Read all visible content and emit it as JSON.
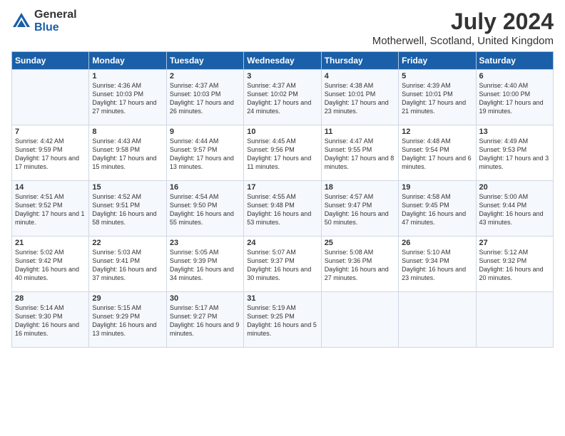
{
  "header": {
    "logo_general": "General",
    "logo_blue": "Blue",
    "title": "July 2024",
    "subtitle": "Motherwell, Scotland, United Kingdom"
  },
  "weekdays": [
    "Sunday",
    "Monday",
    "Tuesday",
    "Wednesday",
    "Thursday",
    "Friday",
    "Saturday"
  ],
  "weeks": [
    [
      {
        "day": "",
        "sunrise": "",
        "sunset": "",
        "daylight": ""
      },
      {
        "day": "1",
        "sunrise": "Sunrise: 4:36 AM",
        "sunset": "Sunset: 10:03 PM",
        "daylight": "Daylight: 17 hours and 27 minutes."
      },
      {
        "day": "2",
        "sunrise": "Sunrise: 4:37 AM",
        "sunset": "Sunset: 10:03 PM",
        "daylight": "Daylight: 17 hours and 26 minutes."
      },
      {
        "day": "3",
        "sunrise": "Sunrise: 4:37 AM",
        "sunset": "Sunset: 10:02 PM",
        "daylight": "Daylight: 17 hours and 24 minutes."
      },
      {
        "day": "4",
        "sunrise": "Sunrise: 4:38 AM",
        "sunset": "Sunset: 10:01 PM",
        "daylight": "Daylight: 17 hours and 23 minutes."
      },
      {
        "day": "5",
        "sunrise": "Sunrise: 4:39 AM",
        "sunset": "Sunset: 10:01 PM",
        "daylight": "Daylight: 17 hours and 21 minutes."
      },
      {
        "day": "6",
        "sunrise": "Sunrise: 4:40 AM",
        "sunset": "Sunset: 10:00 PM",
        "daylight": "Daylight: 17 hours and 19 minutes."
      }
    ],
    [
      {
        "day": "7",
        "sunrise": "Sunrise: 4:42 AM",
        "sunset": "Sunset: 9:59 PM",
        "daylight": "Daylight: 17 hours and 17 minutes."
      },
      {
        "day": "8",
        "sunrise": "Sunrise: 4:43 AM",
        "sunset": "Sunset: 9:58 PM",
        "daylight": "Daylight: 17 hours and 15 minutes."
      },
      {
        "day": "9",
        "sunrise": "Sunrise: 4:44 AM",
        "sunset": "Sunset: 9:57 PM",
        "daylight": "Daylight: 17 hours and 13 minutes."
      },
      {
        "day": "10",
        "sunrise": "Sunrise: 4:45 AM",
        "sunset": "Sunset: 9:56 PM",
        "daylight": "Daylight: 17 hours and 11 minutes."
      },
      {
        "day": "11",
        "sunrise": "Sunrise: 4:47 AM",
        "sunset": "Sunset: 9:55 PM",
        "daylight": "Daylight: 17 hours and 8 minutes."
      },
      {
        "day": "12",
        "sunrise": "Sunrise: 4:48 AM",
        "sunset": "Sunset: 9:54 PM",
        "daylight": "Daylight: 17 hours and 6 minutes."
      },
      {
        "day": "13",
        "sunrise": "Sunrise: 4:49 AM",
        "sunset": "Sunset: 9:53 PM",
        "daylight": "Daylight: 17 hours and 3 minutes."
      }
    ],
    [
      {
        "day": "14",
        "sunrise": "Sunrise: 4:51 AM",
        "sunset": "Sunset: 9:52 PM",
        "daylight": "Daylight: 17 hours and 1 minute."
      },
      {
        "day": "15",
        "sunrise": "Sunrise: 4:52 AM",
        "sunset": "Sunset: 9:51 PM",
        "daylight": "Daylight: 16 hours and 58 minutes."
      },
      {
        "day": "16",
        "sunrise": "Sunrise: 4:54 AM",
        "sunset": "Sunset: 9:50 PM",
        "daylight": "Daylight: 16 hours and 55 minutes."
      },
      {
        "day": "17",
        "sunrise": "Sunrise: 4:55 AM",
        "sunset": "Sunset: 9:48 PM",
        "daylight": "Daylight: 16 hours and 53 minutes."
      },
      {
        "day": "18",
        "sunrise": "Sunrise: 4:57 AM",
        "sunset": "Sunset: 9:47 PM",
        "daylight": "Daylight: 16 hours and 50 minutes."
      },
      {
        "day": "19",
        "sunrise": "Sunrise: 4:58 AM",
        "sunset": "Sunset: 9:45 PM",
        "daylight": "Daylight: 16 hours and 47 minutes."
      },
      {
        "day": "20",
        "sunrise": "Sunrise: 5:00 AM",
        "sunset": "Sunset: 9:44 PM",
        "daylight": "Daylight: 16 hours and 43 minutes."
      }
    ],
    [
      {
        "day": "21",
        "sunrise": "Sunrise: 5:02 AM",
        "sunset": "Sunset: 9:42 PM",
        "daylight": "Daylight: 16 hours and 40 minutes."
      },
      {
        "day": "22",
        "sunrise": "Sunrise: 5:03 AM",
        "sunset": "Sunset: 9:41 PM",
        "daylight": "Daylight: 16 hours and 37 minutes."
      },
      {
        "day": "23",
        "sunrise": "Sunrise: 5:05 AM",
        "sunset": "Sunset: 9:39 PM",
        "daylight": "Daylight: 16 hours and 34 minutes."
      },
      {
        "day": "24",
        "sunrise": "Sunrise: 5:07 AM",
        "sunset": "Sunset: 9:37 PM",
        "daylight": "Daylight: 16 hours and 30 minutes."
      },
      {
        "day": "25",
        "sunrise": "Sunrise: 5:08 AM",
        "sunset": "Sunset: 9:36 PM",
        "daylight": "Daylight: 16 hours and 27 minutes."
      },
      {
        "day": "26",
        "sunrise": "Sunrise: 5:10 AM",
        "sunset": "Sunset: 9:34 PM",
        "daylight": "Daylight: 16 hours and 23 minutes."
      },
      {
        "day": "27",
        "sunrise": "Sunrise: 5:12 AM",
        "sunset": "Sunset: 9:32 PM",
        "daylight": "Daylight: 16 hours and 20 minutes."
      }
    ],
    [
      {
        "day": "28",
        "sunrise": "Sunrise: 5:14 AM",
        "sunset": "Sunset: 9:30 PM",
        "daylight": "Daylight: 16 hours and 16 minutes."
      },
      {
        "day": "29",
        "sunrise": "Sunrise: 5:15 AM",
        "sunset": "Sunset: 9:29 PM",
        "daylight": "Daylight: 16 hours and 13 minutes."
      },
      {
        "day": "30",
        "sunrise": "Sunrise: 5:17 AM",
        "sunset": "Sunset: 9:27 PM",
        "daylight": "Daylight: 16 hours and 9 minutes."
      },
      {
        "day": "31",
        "sunrise": "Sunrise: 5:19 AM",
        "sunset": "Sunset: 9:25 PM",
        "daylight": "Daylight: 16 hours and 5 minutes."
      },
      {
        "day": "",
        "sunrise": "",
        "sunset": "",
        "daylight": ""
      },
      {
        "day": "",
        "sunrise": "",
        "sunset": "",
        "daylight": ""
      },
      {
        "day": "",
        "sunrise": "",
        "sunset": "",
        "daylight": ""
      }
    ]
  ]
}
